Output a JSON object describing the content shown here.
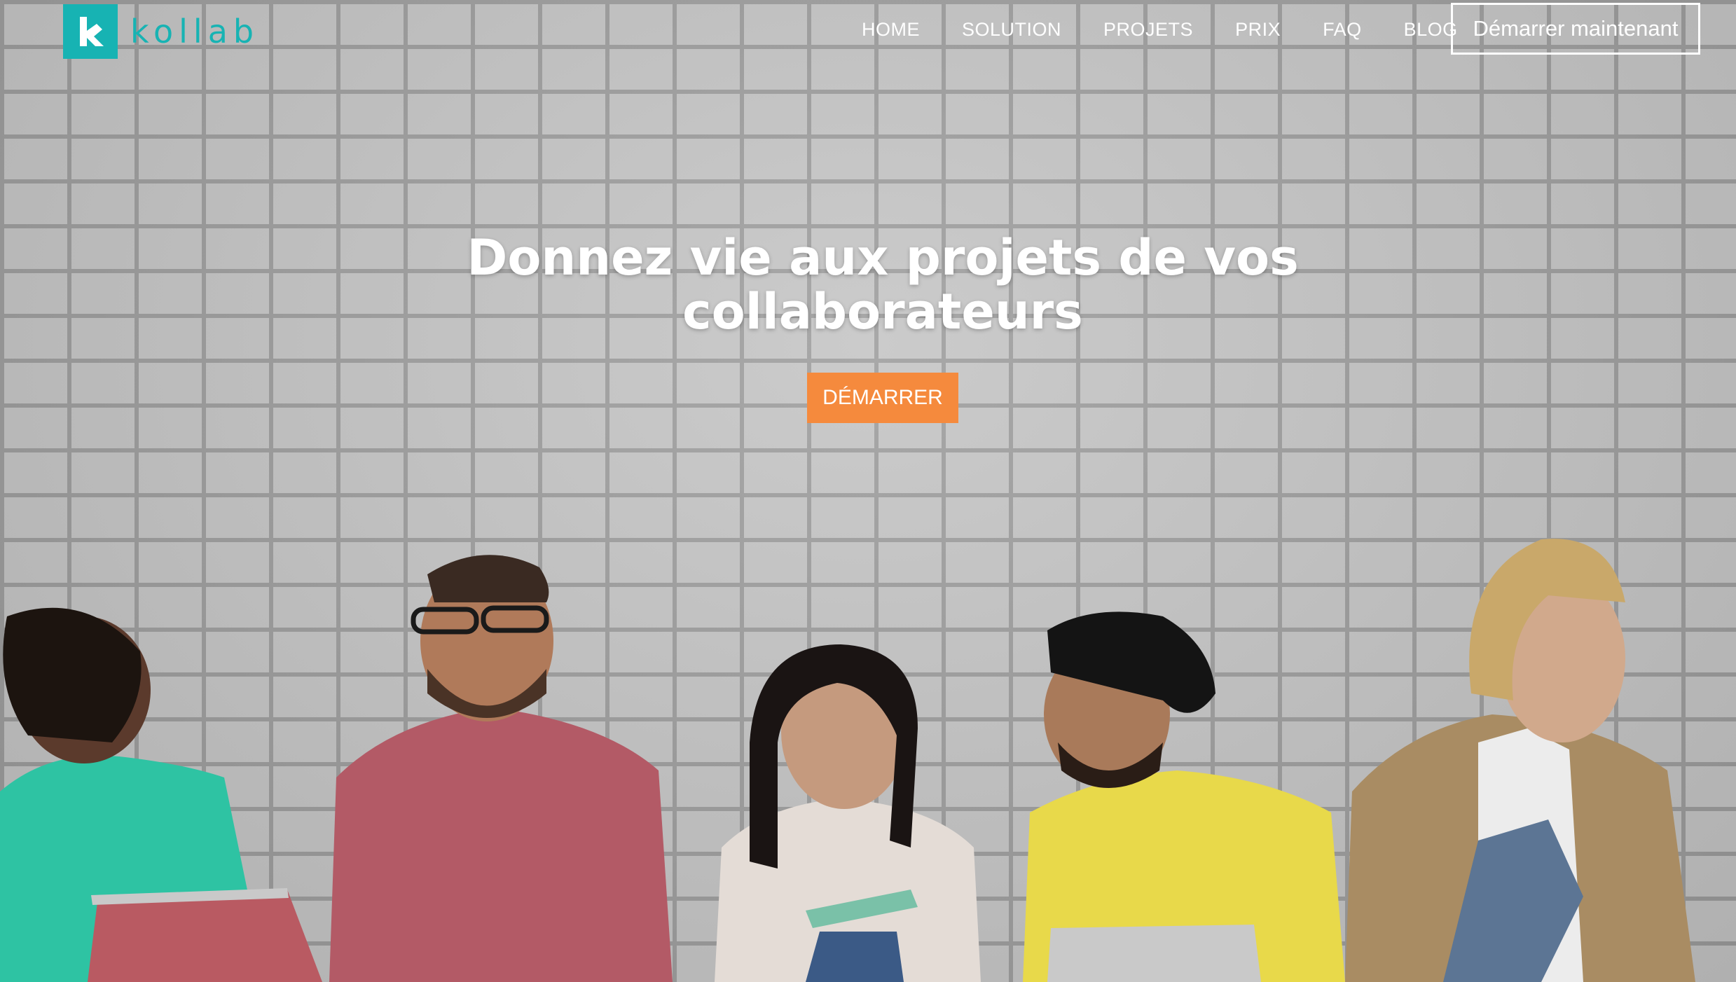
{
  "brand": {
    "name": "kollab",
    "logo_icon": "k-logo-icon",
    "color": "#17b3b3"
  },
  "nav": {
    "items": [
      {
        "label": "HOME"
      },
      {
        "label": "SOLUTION"
      },
      {
        "label": "PROJETS"
      },
      {
        "label": "PRIX"
      },
      {
        "label": "FAQ"
      },
      {
        "label": "BLOG"
      }
    ],
    "cta_label": "Démarrer maintenant"
  },
  "hero": {
    "headline_line1": "Donnez vie aux projets de vos",
    "headline_line2": "collaborateurs",
    "button_label": "DÉMARRER",
    "button_color": "#f58a3d",
    "background": "photo of five colleagues sitting against a white brick wall"
  }
}
